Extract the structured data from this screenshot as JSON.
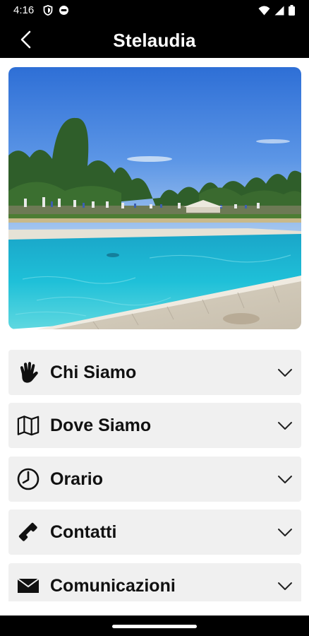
{
  "status_bar": {
    "time": "4:16",
    "icons_left": [
      "shield-icon",
      "vpn-icon"
    ],
    "icons_right": [
      "wifi-icon",
      "signal-icon",
      "battery-icon"
    ]
  },
  "app_bar": {
    "title": "Stelaudia",
    "back_icon": "back-arrow-icon"
  },
  "hero_image": {
    "subject": "pool-landscape-photo"
  },
  "sections": [
    {
      "label": "Chi Siamo",
      "icon": "hand-icon"
    },
    {
      "label": "Dove Siamo",
      "icon": "map-icon"
    },
    {
      "label": "Orario",
      "icon": "clock-icon"
    },
    {
      "label": "Contatti",
      "icon": "phone-icon"
    },
    {
      "label": "Comunicazioni",
      "icon": "envelope-icon"
    }
  ],
  "colors": {
    "bar_background": "#000000",
    "section_background": "#f0f0f0",
    "text": "#111111"
  }
}
